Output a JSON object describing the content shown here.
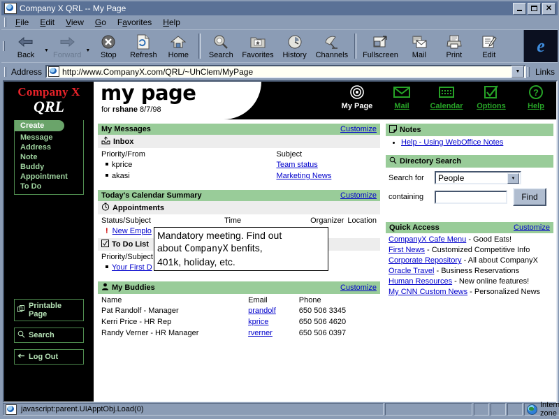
{
  "window": {
    "title": "Company X QRL -- My Page",
    "icon": "ie-document-icon",
    "buttons": {
      "minimize": "_",
      "maximize": "□",
      "close": "✕"
    }
  },
  "menubar": [
    {
      "label": "File",
      "accel": "F"
    },
    {
      "label": "Edit",
      "accel": "E"
    },
    {
      "label": "View",
      "accel": "V"
    },
    {
      "label": "Go",
      "accel": "G"
    },
    {
      "label": "Favorites",
      "accel": "a"
    },
    {
      "label": "Help",
      "accel": "H"
    }
  ],
  "toolbar": [
    {
      "label": "Back",
      "icon": "back-arrow-icon",
      "disabled": false,
      "dropdown": true
    },
    {
      "label": "Forward",
      "icon": "forward-arrow-icon",
      "disabled": true,
      "dropdown": true
    },
    {
      "label": "Stop",
      "icon": "stop-icon",
      "disabled": false,
      "dropdown": false
    },
    {
      "label": "Refresh",
      "icon": "refresh-icon",
      "disabled": false,
      "dropdown": false
    },
    {
      "label": "Home",
      "icon": "home-icon",
      "disabled": false,
      "dropdown": false
    },
    {
      "label": "Search",
      "icon": "search-icon",
      "disabled": false,
      "dropdown": false
    },
    {
      "label": "Favorites",
      "icon": "favorites-folder-icon",
      "disabled": false,
      "dropdown": false
    },
    {
      "label": "History",
      "icon": "history-clock-icon",
      "disabled": false,
      "dropdown": false
    },
    {
      "label": "Channels",
      "icon": "channels-satellite-icon",
      "disabled": false,
      "dropdown": false
    },
    {
      "label": "Fullscreen",
      "icon": "fullscreen-icon",
      "disabled": false,
      "dropdown": false
    },
    {
      "label": "Mail",
      "icon": "mail-icon",
      "disabled": false,
      "dropdown": false
    },
    {
      "label": "Print",
      "icon": "printer-icon",
      "disabled": false,
      "dropdown": false
    },
    {
      "label": "Edit",
      "icon": "edit-pencil-icon",
      "disabled": false,
      "dropdown": false
    }
  ],
  "address": {
    "label": "Address",
    "url": "http://www.CompanyX.com/QRL/~UhClem/MyPage",
    "links_label": "Links"
  },
  "sidebar": {
    "brand_line1": "Company X",
    "brand_line2": "QRL",
    "create_header": "Create",
    "create_items": [
      "Message",
      "Address",
      "Note",
      "Buddy",
      "Appointment",
      "To Do"
    ],
    "buttons": [
      {
        "label": "Printable Page",
        "icon": "printable-page-icon"
      },
      {
        "label": "Search",
        "icon": "search-icon"
      },
      {
        "label": "Log Out",
        "icon": "logout-arrow-icon"
      }
    ]
  },
  "banner": {
    "title": "my page",
    "for_label": "for",
    "user": "rshane",
    "date": "8/7/98"
  },
  "topnav": [
    {
      "label": "My Page",
      "icon": "target-icon",
      "active": true
    },
    {
      "label": "Mail",
      "icon": "envelope-icon",
      "active": false
    },
    {
      "label": "Calendar",
      "icon": "calendar-icon",
      "active": false
    },
    {
      "label": "Options",
      "icon": "checkbox-icon",
      "active": false
    },
    {
      "label": "Help",
      "icon": "question-circle-icon",
      "active": false
    }
  ],
  "customize_label": "Customize",
  "messages": {
    "title": "My Messages",
    "subhead": "Inbox",
    "subhead_icon": "inbox-tray-icon",
    "columns": [
      "Priority/From",
      "Subject"
    ],
    "rows": [
      {
        "from": "kprice",
        "subject": "Team status"
      },
      {
        "from": "akasi",
        "subject": "Marketing News"
      }
    ]
  },
  "calendar": {
    "title": "Today's Calendar Summary",
    "subhead": "Appointments",
    "subhead_icon": "clock-icon",
    "columns": [
      "Status/Subject",
      "Time",
      "Organizer",
      "Location"
    ],
    "rows": [
      {
        "priority": "!",
        "subject": "New Emplo",
        "time": "",
        "organizer": "",
        "location": ""
      }
    ],
    "todo_subhead": "To Do List",
    "todo_subhead_icon": "checkbox-icon",
    "todo_columns": [
      "Priority/Subject"
    ],
    "todo_rows": [
      {
        "subject": "Your First D"
      }
    ]
  },
  "buddies": {
    "title": "My Buddies",
    "title_icon": "person-icon",
    "columns": [
      "Name",
      "Email",
      "Phone"
    ],
    "rows": [
      {
        "name": "Pat Randolf - Manager",
        "email": "prandolf",
        "phone": "650 506 3345"
      },
      {
        "name": "Kerri Price - HR Rep",
        "email": "kprice",
        "phone": "650 506 4620"
      },
      {
        "name": "Randy Verner - HR Manager",
        "email": "rverner",
        "phone": "650 506 0397"
      }
    ]
  },
  "notes": {
    "title": "Notes",
    "title_icon": "note-icon",
    "items": [
      "Help - Using WebOffice Notes"
    ]
  },
  "directory_search": {
    "title": "Directory Search",
    "title_icon": "magnifier-icon",
    "search_for_label": "Search for",
    "search_for_value": "People",
    "containing_label": "containing",
    "containing_value": "",
    "find_button": "Find"
  },
  "quick_access": {
    "title": "Quick Access",
    "items": [
      {
        "link": "CompanyX Cafe Menu",
        "desc": " - Good Eats!"
      },
      {
        "link": "First News",
        "desc": " - Customized Competitive Info"
      },
      {
        "link": "Corporate Repository",
        "desc": " - All about CompanyX"
      },
      {
        "link": "Oracle Travel",
        "desc": " - Business Reservations"
      },
      {
        "link": "Human Resources",
        "desc": " - New online features!"
      },
      {
        "link": "My CNN Custom News",
        "desc": " - Personalized News"
      }
    ]
  },
  "tooltip": {
    "line1": "Mandatory meeting. Find out",
    "line2_pre": "about ",
    "line2_mono": "CompanyX",
    "line2_post": " benfits,",
    "line3": "401k, holiday, etc."
  },
  "statusbar": {
    "message": "javascript:parent.UIApptObj.Load(0)",
    "zone": "Internet zone",
    "zone_icon": "globe-icon"
  },
  "colors": {
    "panel_header_green": "#99cc99",
    "link_blue": "#0000cc",
    "brand_red": "#e8232a",
    "nav_green": "#27a327",
    "chrome_blue": "#8b9cb5"
  }
}
